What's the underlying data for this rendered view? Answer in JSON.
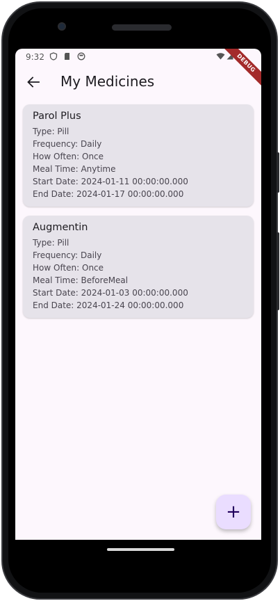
{
  "status_bar": {
    "time": "9:32",
    "debug_label": "DEBUG"
  },
  "app_bar": {
    "title": "My Medicines"
  },
  "medicines": [
    {
      "name": "Parol Plus",
      "type": "Type: Pill",
      "frequency": "Frequency: Daily",
      "how_often": "How Often: Once",
      "meal_time": "Meal Time: Anytime",
      "start_date": "Start Date: 2024-01-11 00:00:00.000",
      "end_date": "End Date: 2024-01-17 00:00:00.000"
    },
    {
      "name": "Augmentin",
      "type": "Type: Pill",
      "frequency": "Frequency: Daily",
      "how_often": "How Often: Once",
      "meal_time": "Meal Time: BeforeMeal",
      "start_date": "Start Date: 2024-01-03 00:00:00.000",
      "end_date": "End Date: 2024-01-24 00:00:00.000"
    }
  ],
  "fab": {
    "icon": "plus-icon",
    "symbol": "+"
  },
  "colors": {
    "background": "#fdf7fd",
    "card": "#e6e3ea",
    "fab": "#eaddff",
    "debug_ribbon": "#a32a2a"
  }
}
